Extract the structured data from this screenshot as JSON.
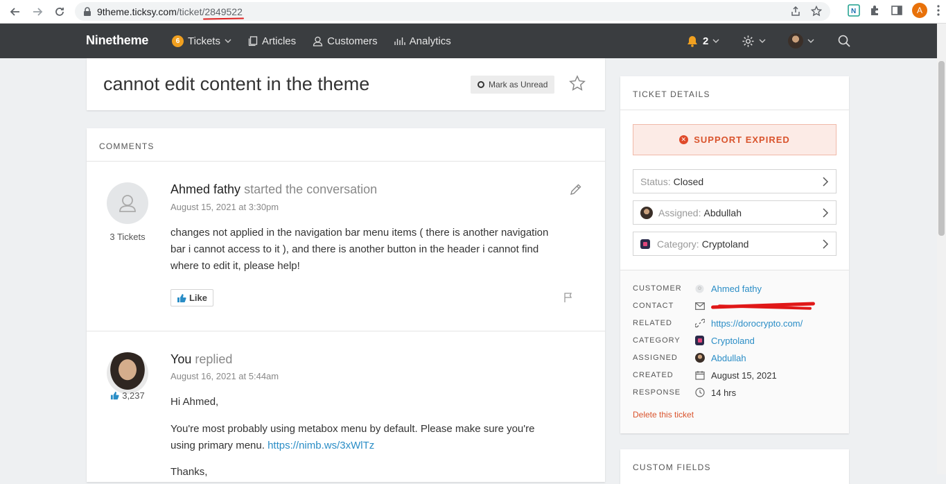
{
  "browser": {
    "url_host": "9theme.ticksy.com",
    "url_path": "/ticket/",
    "url_ticket_id": "2849522",
    "profile_initial": "A"
  },
  "appnav": {
    "brand": "Ninetheme",
    "tickets_count": "6",
    "tickets_label": "Tickets",
    "articles_label": "Articles",
    "customers_label": "Customers",
    "analytics_label": "Analytics",
    "notifications_count": "2"
  },
  "ticket": {
    "title": "cannot edit content in the theme",
    "mark_unread_label": "Mark as Unread"
  },
  "comments": {
    "section_label": "COMMENTS",
    "items": [
      {
        "author": "Ahmed fathy",
        "action": "started the conversation",
        "date": "August 15, 2021 at 3:30pm",
        "under_avatar": "3 Tickets",
        "body": "changes not applied in the navigation bar menu items ( there is another navigation bar i cannot access to it ), and there is another button in the header i cannot find where to edit it, please help!",
        "like_label": "Like"
      },
      {
        "author": "You",
        "action": "replied",
        "date": "August 16, 2021 at 5:44am",
        "under_avatar": "3,237",
        "greeting": "Hi Ahmed,",
        "body_text": "You're most probably using metabox menu by default. Please make sure you're using primary menu.",
        "body_link": "https://nimb.ws/3xWlTz",
        "closing": "Thanks,"
      }
    ]
  },
  "details": {
    "section_label": "TICKET DETAILS",
    "support_status": "SUPPORT EXPIRED",
    "status_key": "Status:",
    "status_value": "Closed",
    "assigned_key": "Assigned:",
    "assigned_value": "Abdullah",
    "category_key": "Category:",
    "category_value": "Cryptoland",
    "meta": {
      "customer_label": "CUSTOMER",
      "customer_value": "Ahmed fathy",
      "contact_label": "CONTACT",
      "related_label": "RELATED",
      "related_value": "https://dorocrypto.com/",
      "category_label": "CATEGORY",
      "category_value": "Cryptoland",
      "assigned_label": "ASSIGNED",
      "assigned_value": "Abdullah",
      "created_label": "CREATED",
      "created_value": "August 15, 2021",
      "response_label": "RESPONSE",
      "response_value": "14 hrs"
    },
    "delete_label": "Delete this ticket"
  },
  "custom_fields": {
    "section_label": "CUSTOM FIELDS"
  },
  "colors": {
    "nav_bg": "#3a3d40",
    "accent_link": "#2a8dc6",
    "expired_text": "#d9532c",
    "badge": "#f0a020"
  }
}
